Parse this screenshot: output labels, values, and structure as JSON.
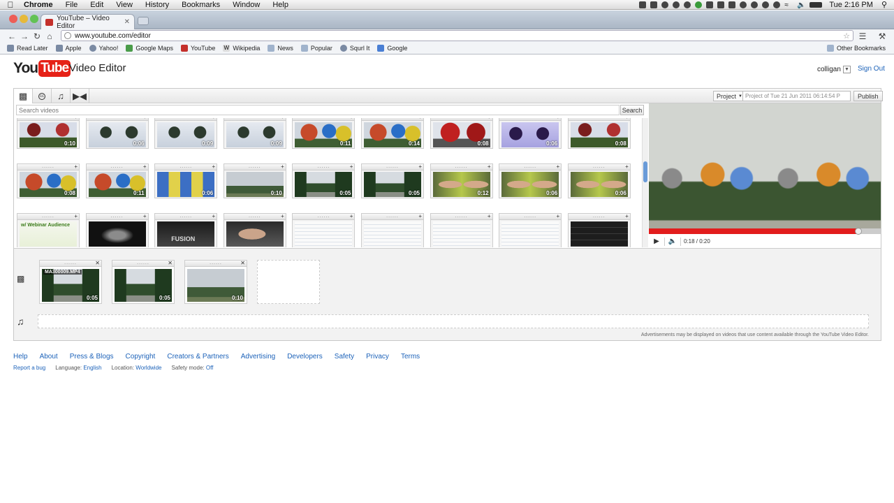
{
  "menubar": {
    "app": "Chrome",
    "items": [
      "File",
      "Edit",
      "View",
      "History",
      "Bookmarks",
      "Window",
      "Help"
    ],
    "clock": "Tue 2:16 PM"
  },
  "tab": {
    "title": "YouTube – Video Editor"
  },
  "omnibox": {
    "url": "www.youtube.com/editor"
  },
  "bookmarks": {
    "items": [
      "Read Later",
      "Apple",
      "Yahoo!",
      "Google Maps",
      "YouTube",
      "Wikipedia",
      "News",
      "Popular",
      "Squrl It",
      "Google"
    ],
    "other": "Other Bookmarks"
  },
  "header": {
    "logo_you": "You",
    "logo_tube": "Tube",
    "title": "Video Editor",
    "username": "colligan",
    "sign_out": "Sign Out"
  },
  "editor": {
    "project_label": "Project",
    "project_name": "Project of Tue 21 Jun 2011 06:14:54 P",
    "publish": "Publish",
    "search_placeholder": "Search videos",
    "search_button": "Search",
    "player_time": "0:18 / 0:20",
    "player_progress": 0.9,
    "ad_note": "Advertisements may be displayed on videos that use content available through the YouTube Video Editor."
  },
  "clips": [
    {
      "dur": "0:10",
      "theme": "balloon-dark"
    },
    {
      "dur": "0:06",
      "theme": "balloon-sky"
    },
    {
      "dur": "0:09",
      "theme": "balloon-sky"
    },
    {
      "dur": "0:09",
      "theme": "balloon-sky"
    },
    {
      "dur": "0:11",
      "theme": "balloon-multi"
    },
    {
      "dur": "0:14",
      "theme": "balloon-multi"
    },
    {
      "dur": "0:08",
      "theme": "balloon-red"
    },
    {
      "dur": "0:06",
      "theme": "balloon-purple"
    },
    {
      "dur": "0:08",
      "theme": "balloon-dark"
    },
    {
      "dur": "0:08",
      "theme": "balloon-multi"
    },
    {
      "dur": "0:11",
      "theme": "balloon-multi"
    },
    {
      "dur": "0:06",
      "theme": "crowd"
    },
    {
      "dur": "0:10",
      "theme": "field"
    },
    {
      "dur": "0:05",
      "theme": "trees"
    },
    {
      "dur": "0:05",
      "theme": "trees"
    },
    {
      "dur": "0:12",
      "theme": "face"
    },
    {
      "dur": "0:06",
      "theme": "face"
    },
    {
      "dur": "0:06",
      "theme": "face"
    },
    {
      "dur": "",
      "theme": "webinar",
      "caption": "w/ Webinar Audience"
    },
    {
      "dur": "",
      "theme": "dark-slide"
    },
    {
      "dur": "",
      "theme": "fusion",
      "caption": "FUSION"
    },
    {
      "dur": "",
      "theme": "face-close"
    },
    {
      "dur": "",
      "theme": "screen"
    },
    {
      "dur": "",
      "theme": "screen"
    },
    {
      "dur": "",
      "theme": "screen"
    },
    {
      "dur": "",
      "theme": "screen"
    },
    {
      "dur": "",
      "theme": "list-slide"
    }
  ],
  "timeline": [
    {
      "dur": "0:05",
      "theme": "trees",
      "filename": "MA300009.MP4"
    },
    {
      "dur": "0:05",
      "theme": "trees",
      "filename": ""
    },
    {
      "dur": "0:10",
      "theme": "field",
      "filename": ""
    }
  ],
  "footer": {
    "links": [
      "Help",
      "About",
      "Press & Blogs",
      "Copyright",
      "Creators & Partners",
      "Advertising",
      "Developers",
      "Safety",
      "Privacy",
      "Terms"
    ],
    "report_bug": "Report a bug",
    "language_label": "Language:",
    "language_value": "English",
    "location_label": "Location:",
    "location_value": "Worldwide",
    "safety_label": "Safety mode:",
    "safety_value": "Off"
  },
  "colors": {
    "youtube_red": "#e62117",
    "link_blue": "#1c62b9",
    "progress_red": "#e21d1d"
  }
}
